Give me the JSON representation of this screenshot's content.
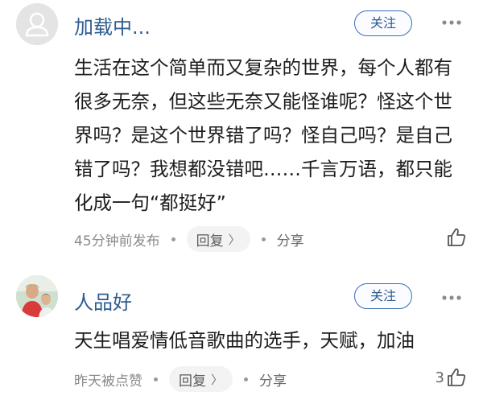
{
  "comments": [
    {
      "username": "加载中...",
      "follow_label": "关注",
      "text": "生活在这个简单而又复杂的世界，每个人都有很多无奈，但这些无奈又能怪谁呢？怪这个世界吗？是这个世界错了吗？怪自己吗？是自己错了吗？我想都没错吧……千言万语，都只能化成一句“都挺好”",
      "time": "45分钟前发布",
      "reply_label": "回复",
      "reply_chevron": "〉",
      "share_label": "分享",
      "like_count": "",
      "avatar_icon": "default-user-icon"
    },
    {
      "username": "人品好",
      "follow_label": "关注",
      "text": "天生唱爱情低音歌曲的选手，天赋，加油",
      "time": "昨天被点赞",
      "reply_label": "回复",
      "reply_chevron": "〉",
      "share_label": "分享",
      "like_count": "3",
      "avatar_icon": "user-photo"
    }
  ],
  "colors": {
    "username": "#2f5c8f",
    "follow_border": "#3b6fb0",
    "meta": "#8a8a8a",
    "reply_bg": "#f3f3f3"
  }
}
